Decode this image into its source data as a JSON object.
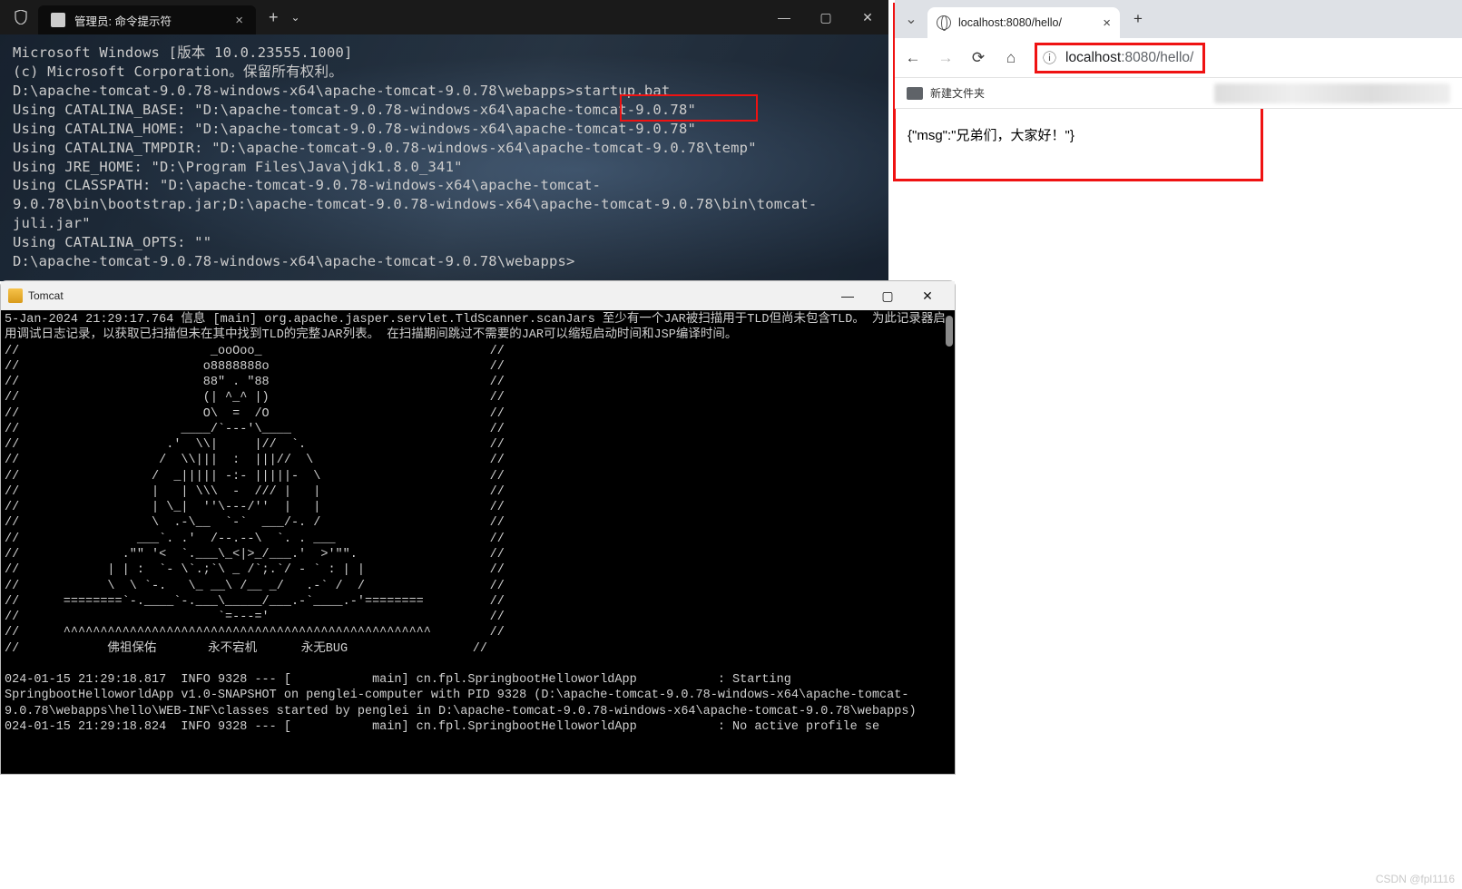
{
  "cmd": {
    "tab_title": "管理员: 命令提示符",
    "lines": [
      "Microsoft Windows [版本 10.0.23555.1000]",
      "(c) Microsoft Corporation。保留所有权利。",
      "",
      "D:\\apache-tomcat-9.0.78-windows-x64\\apache-tomcat-9.0.78\\webapps>startup.bat",
      "Using CATALINA_BASE:   \"D:\\apache-tomcat-9.0.78-windows-x64\\apache-tomcat-9.0.78\"",
      "Using CATALINA_HOME:   \"D:\\apache-tomcat-9.0.78-windows-x64\\apache-tomcat-9.0.78\"",
      "Using CATALINA_TMPDIR: \"D:\\apache-tomcat-9.0.78-windows-x64\\apache-tomcat-9.0.78\\temp\"",
      "Using JRE_HOME:        \"D:\\Program Files\\Java\\jdk1.8.0_341\"",
      "Using CLASSPATH:       \"D:\\apache-tomcat-9.0.78-windows-x64\\apache-tomcat-9.0.78\\bin\\bootstrap.jar;D:\\apache-tomcat-9.0.78-windows-x64\\apache-tomcat-9.0.78\\bin\\tomcat-juli.jar\"",
      "Using CATALINA_OPTS:   \"\"",
      "D:\\apache-tomcat-9.0.78-windows-x64\\apache-tomcat-9.0.78\\webapps>"
    ]
  },
  "tomcat": {
    "title": "Tomcat",
    "log_header": "5-Jan-2024 21:29:17.764 信息 [main] org.apache.jasper.servlet.TldScanner.scanJars 至少有一个JAR被扫描用于TLD但尚未包含TLD。 为此记录器启用调试日志记录，以获取已扫描但未在其中找到TLD的完整JAR列表。 在扫描期间跳过不需要的JAR可以缩短启动时间和JSP编译时间。",
    "art": "//                          _ooOoo_                               //\n//                         o8888888o                              //\n//                         88\" . \"88                              //\n//                         (| ^_^ |)                              //\n//                         O\\  =  /O                              //\n//                      ____/`---'\\____                           //\n//                    .'  \\\\|     |//  `.                         //\n//                   /  \\\\|||  :  |||//  \\                        //\n//                  /  _||||| -:- |||||-  \\                       //\n//                  |   | \\\\\\  -  /// |   |                       //\n//                  | \\_|  ''\\---/''  |   |                       //\n//                  \\  .-\\__  `-`  ___/-. /                       //\n//                ___`. .'  /--.--\\  `. . ___                     //\n//              .\"\" '<  `.___\\_<|>_/___.'  >'\"\".                  //\n//            | | :  `- \\`.;`\\ _ /`;.`/ - ` : | |                 //\n//            \\  \\ `-.   \\_ __\\ /__ _/   .-` /  /                 //\n//      ========`-.____`-.___\\_____/___.-`____.-'========         //\n//                           `=---='                              //\n//      ^^^^^^^^^^^^^^^^^^^^^^^^^^^^^^^^^^^^^^^^^^^^^^^^^^        //\n//            佛祖保佑       永不宕机      永无BUG                 //",
    "log_lines": [
      "024-01-15 21:29:18.817  INFO 9328 --- [           main] cn.fpl.SpringbootHelloworldApp           : Starting SpringbootHelloworldApp v1.0-SNAPSHOT on penglei-computer with PID 9328 (D:\\apache-tomcat-9.0.78-windows-x64\\apache-tomcat-9.0.78\\webapps\\hello\\WEB-INF\\classes started by penglei in D:\\apache-tomcat-9.0.78-windows-x64\\apache-tomcat-9.0.78\\webapps)",
      "024-01-15 21:29:18.824  INFO 9328 --- [           main] cn.fpl.SpringbootHelloworldApp           : No active profile se"
    ]
  },
  "browser": {
    "tab_title": "localhost:8080/hello/",
    "url_host": "localhost",
    "url_path": ":8080/hello/",
    "bookmark_folder": "新建文件夹",
    "page_text": "{\"msg\":\"兄弟们，大家好！\"}"
  },
  "watermark": "CSDN @fpl1116"
}
